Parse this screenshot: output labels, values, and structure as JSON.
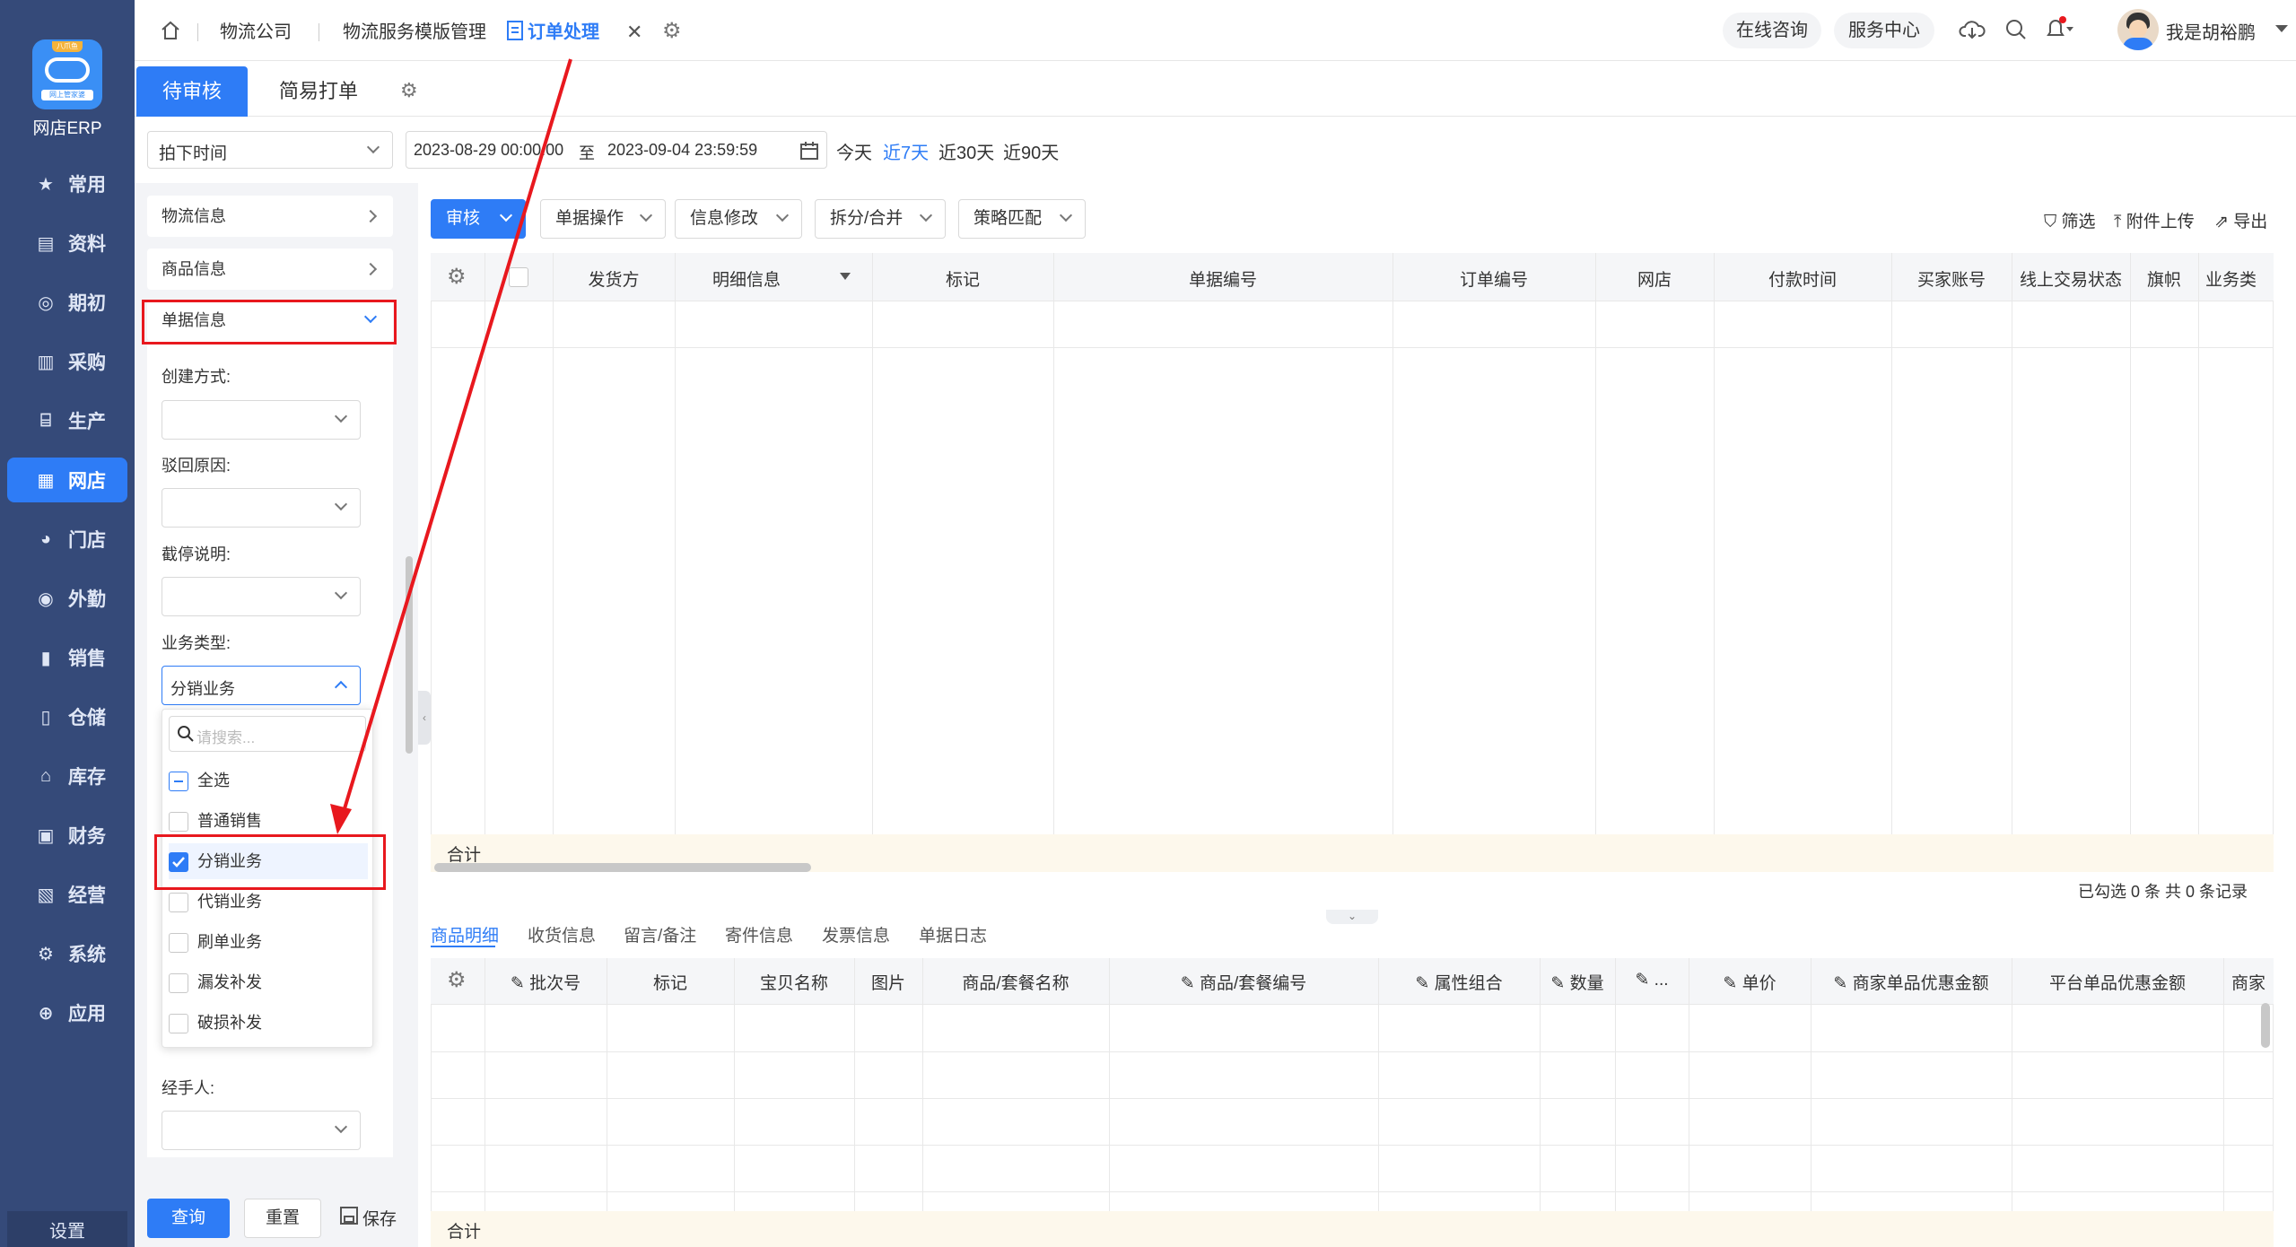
{
  "nav": {
    "app_name": "网店ERP",
    "logo_top": "八爪鱼",
    "logo_ribbon": "网上管家婆",
    "items": [
      {
        "label": "常用",
        "icon": "star-icon",
        "glyph": "★"
      },
      {
        "label": "资料",
        "icon": "document-icon",
        "glyph": "▤"
      },
      {
        "label": "期初",
        "icon": "target-icon",
        "glyph": "◎"
      },
      {
        "label": "采购",
        "icon": "cart-icon",
        "glyph": "▥"
      },
      {
        "label": "生产",
        "icon": "factory-icon",
        "glyph": "⌸"
      },
      {
        "label": "网店",
        "icon": "shop-icon",
        "glyph": "▦"
      },
      {
        "label": "门店",
        "icon": "pie-icon",
        "glyph": "◕"
      },
      {
        "label": "外勤",
        "icon": "location-icon",
        "glyph": "◉"
      },
      {
        "label": "销售",
        "icon": "bar-chart-icon",
        "glyph": "▮"
      },
      {
        "label": "仓储",
        "icon": "warehouse-icon",
        "glyph": "▯"
      },
      {
        "label": "库存",
        "icon": "home-icon",
        "glyph": "⌂"
      },
      {
        "label": "财务",
        "icon": "wallet-icon",
        "glyph": "▣"
      },
      {
        "label": "经营",
        "icon": "chart-icon",
        "glyph": "▧"
      },
      {
        "label": "系统",
        "icon": "gear-icon",
        "glyph": "⚙"
      },
      {
        "label": "应用",
        "icon": "plus-icon",
        "glyph": "⊕"
      }
    ],
    "settings": "设置"
  },
  "topbar": {
    "tabs": [
      "物流公司",
      "物流服务模版管理",
      "订单处理"
    ],
    "online": "在线咨询",
    "service": "服务中心",
    "user": "我是胡裕鹏"
  },
  "subtabs": {
    "pending": "待审核",
    "print": "简易打单"
  },
  "filter": {
    "time_type": "拍下时间",
    "date_from": "2023-08-29 00:00:00",
    "to": "至",
    "date_to": "2023-09-04 23:59:59",
    "quick": [
      "今天",
      "近7天",
      "近30天",
      "近90天"
    ]
  },
  "panel": {
    "logistics": "物流信息",
    "goods": "商品信息",
    "doc": "单据信息",
    "create_mode": "创建方式:",
    "reject_reason": "驳回原因:",
    "stop_note": "截停说明:",
    "biz_type": "业务类型:",
    "biz_value": "分销业务",
    "search_placeholder": "请搜索...",
    "options": [
      "全选",
      "普通销售",
      "分销业务",
      "代销业务",
      "刷单业务",
      "漏发补发",
      "破损补发"
    ],
    "handler": "经手人:",
    "query": "查询",
    "reset": "重置",
    "save": "保存"
  },
  "toolbar": {
    "audit": "审核",
    "doc_ops": "单据操作",
    "info_edit": "信息修改",
    "split": "拆分/合并",
    "strategy": "策略匹配",
    "filter": "筛选",
    "upload": "附件上传",
    "export": "导出"
  },
  "grid": {
    "headers": [
      "发货方",
      "明细信息",
      "标记",
      "单据编号",
      "订单编号",
      "网店",
      "付款时间",
      "买家账号",
      "线上交易状态",
      "旗帜",
      "业务类"
    ],
    "total": "合计",
    "summary": "已勾选 0 条  共 0 条记录"
  },
  "bottom": {
    "tabs": [
      "商品明细",
      "收货信息",
      "留言/备注",
      "寄件信息",
      "发票信息",
      "单据日志"
    ],
    "headers": [
      "批次号",
      "标记",
      "宝贝名称",
      "图片",
      "商品/套餐名称",
      "商品/套餐编号",
      "属性组合",
      "数量",
      "...",
      "单价",
      "商家单品优惠金额",
      "平台单品优惠金额",
      "商家"
    ],
    "total": "合计"
  },
  "colors": {
    "accent": "#2e7cf6",
    "nav_bg": "#354a79",
    "highlight": "#e8181e"
  }
}
